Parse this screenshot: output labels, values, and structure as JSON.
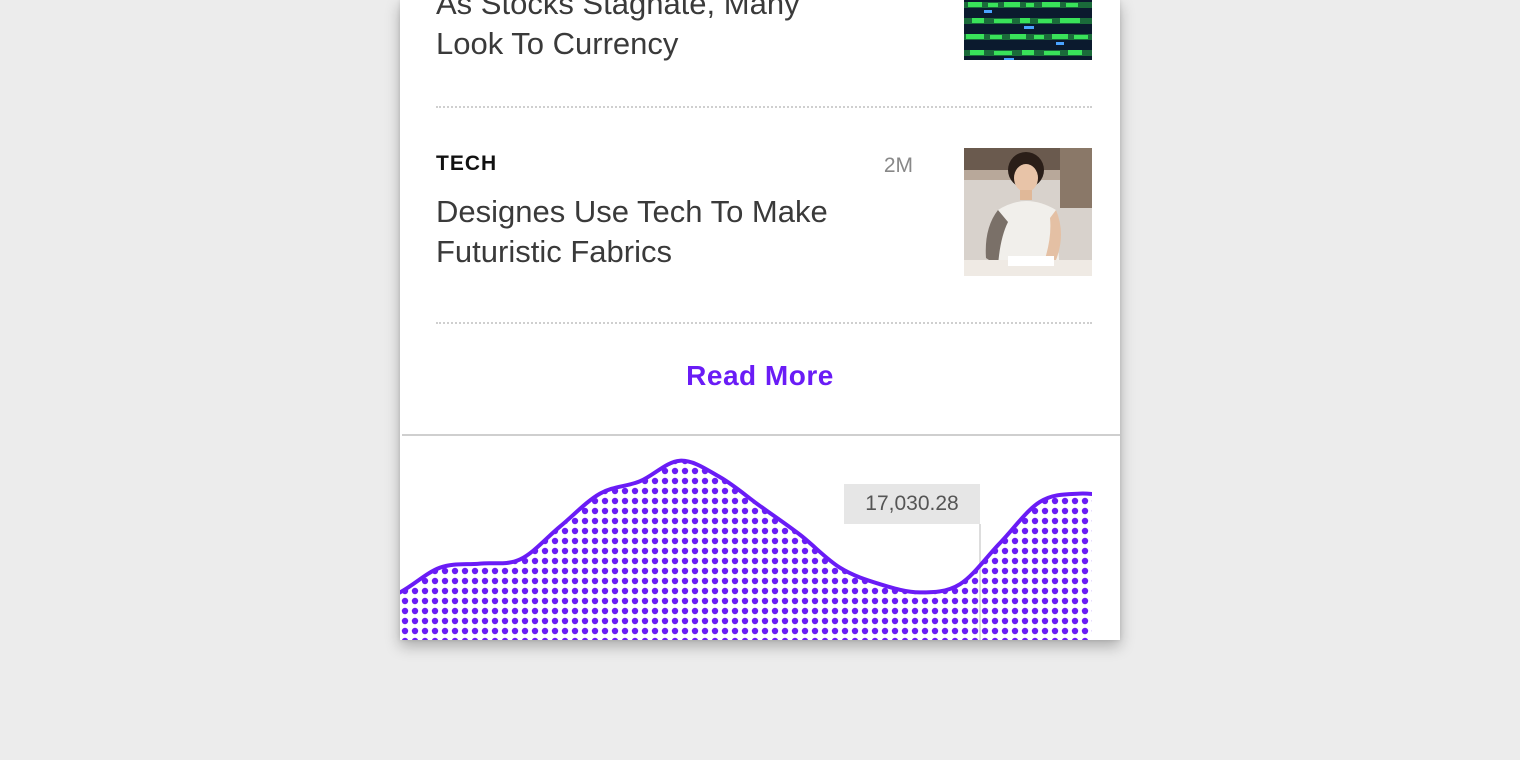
{
  "articles": [
    {
      "category": "",
      "age": "",
      "headline_line1": "As Stocks Stagnate, Many",
      "headline_line2": "Look To Currency",
      "thumbnail": "stock-ticker-board"
    },
    {
      "category": "TECH",
      "age": "2M",
      "headline_line1": "Designes Use Tech To Make",
      "headline_line2": "Futuristic Fabrics",
      "thumbnail": "woman-drawing-at-desk"
    }
  ],
  "read_more_label": "Read More",
  "colors": {
    "accent": "#6a1cf6",
    "category_text": "#111111",
    "age_text": "#888888",
    "headline_text": "#3a3a3a",
    "page_background": "#ececec"
  },
  "market_chart": {
    "highlight_value": "17,030.28"
  },
  "chart_data": {
    "type": "area",
    "title": "",
    "xlabel": "",
    "ylabel": "",
    "highlighted_label": "17,030.28",
    "highlighted_x": 17,
    "x": [
      0,
      1,
      2,
      3,
      4,
      5,
      6,
      7,
      8,
      9,
      10,
      11,
      12,
      13,
      14,
      15,
      16,
      17,
      18,
      19
    ],
    "series": [
      {
        "values": [
          16850,
          16870,
          16900,
          16905,
          16910,
          16950,
          16990,
          17005,
          17030,
          17010,
          16975,
          16940,
          16900,
          16880,
          16870,
          16880,
          16930,
          16980,
          16990,
          16985
        ]
      }
    ]
  }
}
